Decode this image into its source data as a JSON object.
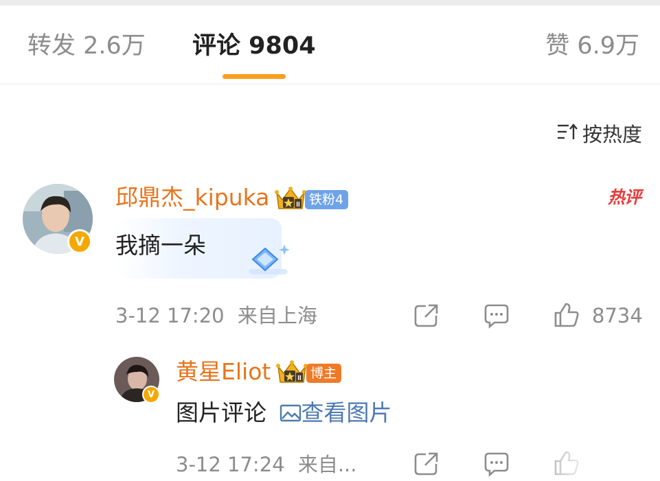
{
  "tabs": [
    {
      "label": "转发 2.6万",
      "active": false
    },
    {
      "label": "评论 9804",
      "active": true
    },
    {
      "label": "赞 6.9万",
      "active": false
    }
  ],
  "accent_color": "#fc9e1d",
  "sort": {
    "label": "按热度"
  },
  "comment": {
    "username": "邱鼎杰_kipuka",
    "fan_badge": "铁粉4",
    "hot_label": "热评",
    "text": "我摘一朵",
    "timestamp": "3-12 17:20",
    "location": "来自上海",
    "like_count": "8734",
    "username_color": "#e8741c",
    "fan_badge_color": "#6fa3e8"
  },
  "reply": {
    "username": "黄星Eliot",
    "author_badge": "博主",
    "text": "图片评论",
    "view_image_label": "查看图片",
    "timestamp": "3-12 17:24",
    "location": "来自...",
    "author_badge_color": "#f07a28"
  },
  "icons": [
    "share-icon",
    "comment-icon",
    "like-icon",
    "sort-icon",
    "crown-icon",
    "verified-icon",
    "image-icon"
  ]
}
